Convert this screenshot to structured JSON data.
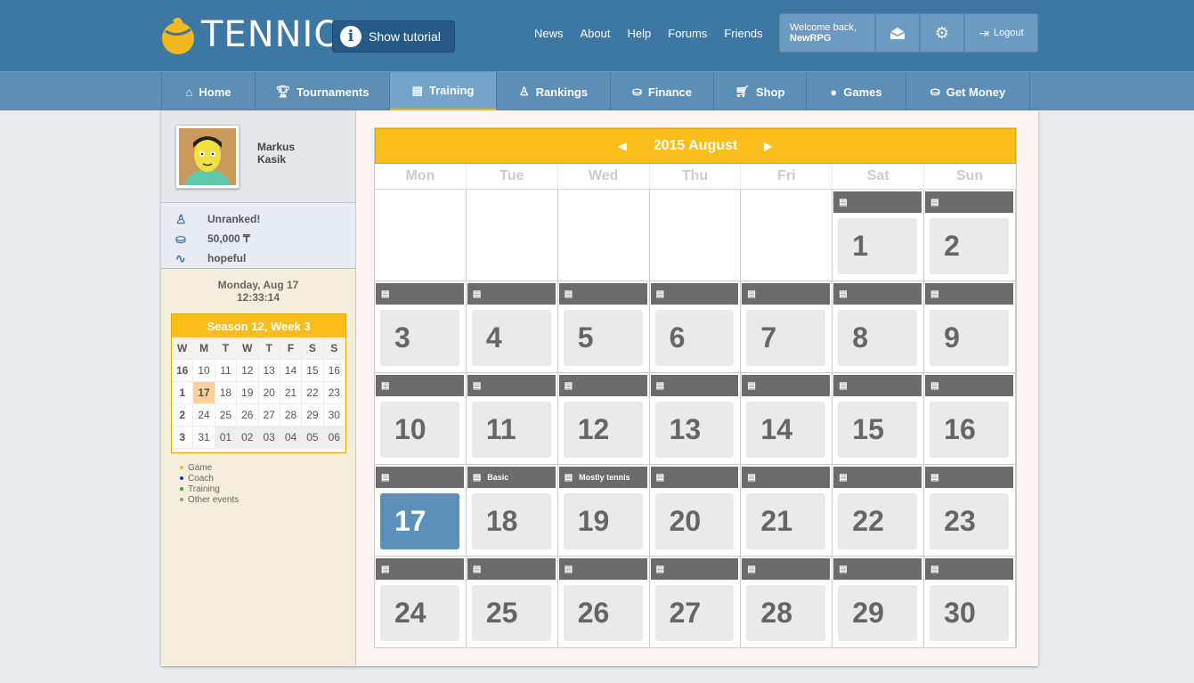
{
  "header": {
    "logo_text": "TENNIO",
    "tutorial_label": "Show tutorial",
    "links": [
      "News",
      "About",
      "Help",
      "Forums",
      "Friends"
    ],
    "welcome_line": "Welcome back,",
    "username": "NewRPG",
    "logout_label": "Logout"
  },
  "nav": {
    "items": [
      {
        "label": "Home",
        "icon": "home-icon"
      },
      {
        "label": "Tournaments",
        "icon": "trophy-icon"
      },
      {
        "label": "Training",
        "icon": "notepad-icon"
      },
      {
        "label": "Rankings",
        "icon": "medal-icon"
      },
      {
        "label": "Finance",
        "icon": "coins-icon"
      },
      {
        "label": "Shop",
        "icon": "cart-icon"
      },
      {
        "label": "Games",
        "icon": "ball-icon"
      },
      {
        "label": "Get Money",
        "icon": "coins-icon"
      }
    ],
    "active": "Training"
  },
  "profile": {
    "first_name": "Markus",
    "last_name": "Kasik",
    "rank": "Unranked!",
    "money": "50,000 ₸",
    "mood": "hopeful",
    "date": "Monday, Aug 17",
    "time": "12:33:14"
  },
  "mini_calendar": {
    "title": "Season 12, Week 3",
    "headers": [
      "W",
      "M",
      "T",
      "W",
      "T",
      "F",
      "S",
      "S"
    ],
    "rows": [
      [
        "16",
        "10",
        "11",
        "12",
        "13",
        "14",
        "15",
        "16"
      ],
      [
        "1",
        "17",
        "18",
        "19",
        "20",
        "21",
        "22",
        "23"
      ],
      [
        "2",
        "24",
        "25",
        "26",
        "27",
        "28",
        "29",
        "30"
      ],
      [
        "3",
        "31",
        "01",
        "02",
        "03",
        "04",
        "05",
        "06"
      ]
    ]
  },
  "legend": [
    {
      "label": "Game",
      "color": "#f3b91e"
    },
    {
      "label": "Coach",
      "color": "#1a2fb0"
    },
    {
      "label": "Training",
      "color": "#3aa53a"
    },
    {
      "label": "Other events",
      "color": "#999999"
    }
  ],
  "calendar": {
    "title": "2015 August",
    "weekdays": [
      "Mon",
      "Tue",
      "Wed",
      "Thu",
      "Fri",
      "Sat",
      "Sun"
    ],
    "today": "17",
    "days": [
      "",
      "",
      "",
      "",
      "",
      "1",
      "2",
      "3",
      "4",
      "5",
      "6",
      "7",
      "8",
      "9",
      "10",
      "11",
      "12",
      "13",
      "14",
      "15",
      "16",
      "17",
      "18",
      "19",
      "20",
      "21",
      "22",
      "23",
      "24",
      "25",
      "26",
      "27",
      "28",
      "29",
      "30"
    ],
    "events": {
      "18": "Basic",
      "19": "Mostly tennis"
    }
  }
}
